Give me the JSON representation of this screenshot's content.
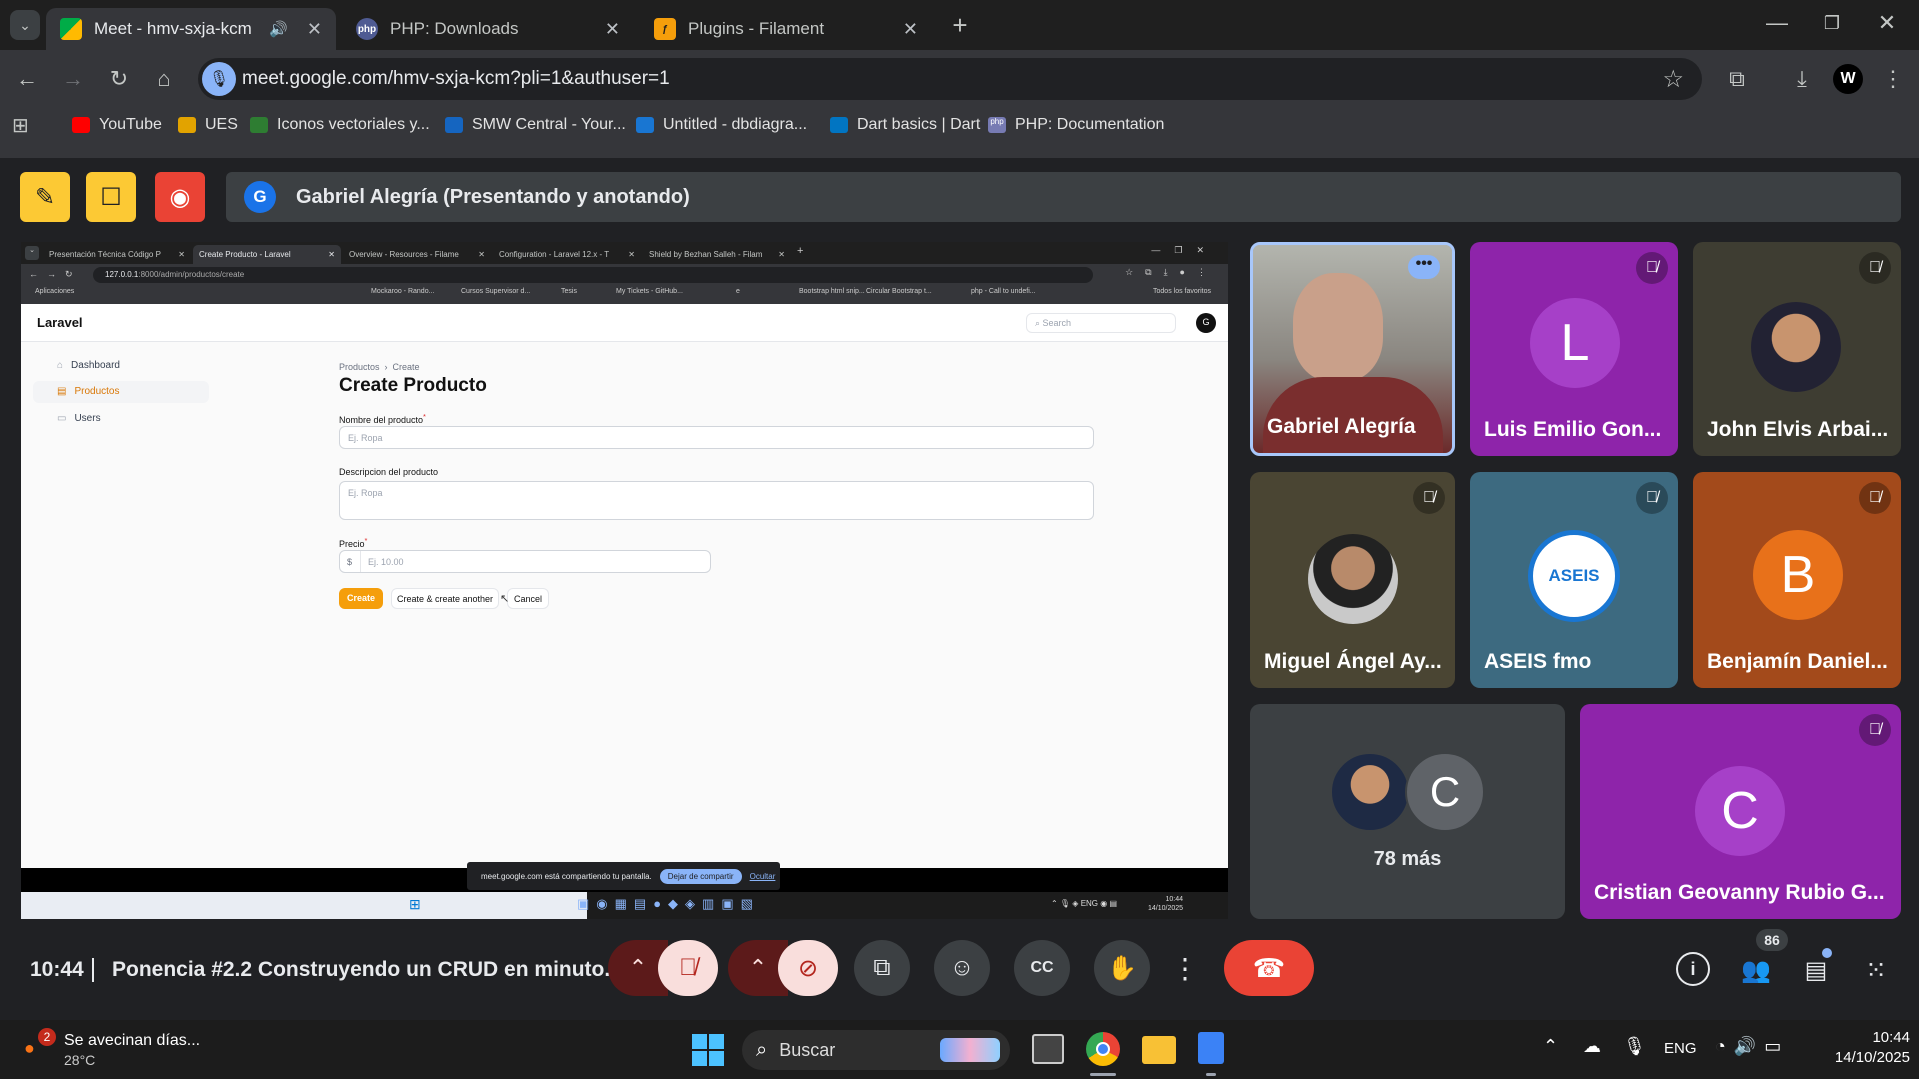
{
  "browser": {
    "tabs": [
      {
        "title": "Meet - hmv-sxja-kcm",
        "active": true,
        "icon": "meet-icon"
      },
      {
        "title": "PHP: Downloads",
        "active": false,
        "icon": "php-icon",
        "icon_text": "php"
      },
      {
        "title": "Plugins - Filament",
        "active": false,
        "icon": "filament-icon"
      }
    ],
    "url": "meet.google.com/hmv-sxja-kcm?pli=1&authuser=1",
    "bookmarks": [
      {
        "label": "YouTube",
        "icon": "youtube-icon",
        "color": "#ff0000"
      },
      {
        "label": "UES",
        "icon": "ues-icon",
        "color": "#e2a300"
      },
      {
        "label": "Iconos vectoriales y...",
        "icon": "vector-icons-icon",
        "color": "#2e7d32"
      },
      {
        "label": "SMW Central - Your...",
        "icon": "smw-icon",
        "color": "#1565c0"
      },
      {
        "label": "Untitled - dbdiagra...",
        "icon": "dbdiagram-icon",
        "color": "#1976d2"
      },
      {
        "label": "Dart basics | Dart",
        "icon": "dart-icon",
        "color": "#0175c2"
      },
      {
        "label": "PHP: Documentation",
        "icon": "php-icon",
        "color": "#777bb3",
        "icon_text": "php"
      }
    ]
  },
  "meet": {
    "presenter_initial": "G",
    "presenter_label": "Gabriel Alegría (Presentando y anotando)",
    "time": "10:44",
    "meeting_title": "Ponencia #2.2 Construyendo un CRUD en minuto...",
    "participant_count": "86",
    "more_count": "78 más",
    "participants": [
      {
        "name": "Gabriel Alegría",
        "type": "video",
        "muted": false,
        "speaking": true
      },
      {
        "name": "Luis Emilio Gon...",
        "initial": "L",
        "bg": "#8e24aa",
        "avatar_bg": "#a640c8",
        "muted": true
      },
      {
        "name": "John Elvis Arbai...",
        "type": "photo",
        "bg": "#3e3d32",
        "muted": true
      },
      {
        "name": "Miguel Ángel Ay...",
        "type": "photo",
        "bg": "#4a4533",
        "muted": true
      },
      {
        "name": "ASEIS fmo",
        "type": "logo",
        "logo_text": "ASEIS",
        "bg": "#3d6a80",
        "muted": true
      },
      {
        "name": "Benjamín Daniel...",
        "initial": "B",
        "bg": "#a34a1b",
        "avatar_bg": "#e8711a",
        "muted": true
      },
      {
        "name": "Cristian Geovanny Rubio G...",
        "initial": "C",
        "bg": "#8e24aa",
        "avatar_bg": "#a640c8",
        "muted": true
      }
    ],
    "more_avatar_initial": "C"
  },
  "shared": {
    "tabs": [
      "Presentación Técnica Código P",
      "Create Producto - Laravel",
      "Overview - Resources - Filame",
      "Configuration - Laravel 12.x - T",
      "Shield by Bezhan Salleh - Filam"
    ],
    "url_host": "127.0.0.1",
    "url_rest": ":8000/admin/productos/create",
    "bookmarks": [
      "Aplicaciones",
      "Mockaroo - Rando...",
      "Cursos Supervisor d...",
      "Tesis",
      "My Tickets - GitHub...",
      "e",
      "Bootstrap html snip...",
      "Circular Bootstrap t...",
      "php - Call to undefi..."
    ],
    "all_favorites": "Todos los favoritos",
    "app_name": "Laravel",
    "search_placeholder": "Search",
    "user_initial": "G",
    "nav": [
      "Dashboard",
      "Productos",
      "Users"
    ],
    "breadcrumb": [
      "Productos",
      "Create"
    ],
    "page_title": "Create Producto",
    "field1_label": "Nombre del producto",
    "field1_placeholder": "Ej. Ropa",
    "field2_label": "Descripcion del producto",
    "field2_placeholder": "Ej. Ropa",
    "field3_label": "Precio",
    "field3_prefix": "$",
    "field3_placeholder": "Ej. 10.00",
    "btn_create": "Create",
    "btn_create_another": "Create & create another",
    "btn_cancel": "Cancel",
    "share_notice": "meet.google.com está compartiendo tu pantalla.",
    "stop_share": "Dejar de compartir",
    "hide": "Ocultar",
    "tray_lang": "ENG",
    "tray_time": "10:44",
    "tray_date": "14/10/2025"
  },
  "taskbar": {
    "weather_badge": "2",
    "weather_text": "Se avecinan días...",
    "temperature": "28°C",
    "search_label": "Buscar",
    "lang": "ENG",
    "time": "10:44",
    "date": "14/10/2025"
  },
  "colors": {
    "accent_yellow": "#fcc934",
    "record_red": "#ea4335",
    "end_call_red": "#ea4335",
    "mic_off_bg": "#f9dedc",
    "filament_amber": "#f59e0b"
  }
}
